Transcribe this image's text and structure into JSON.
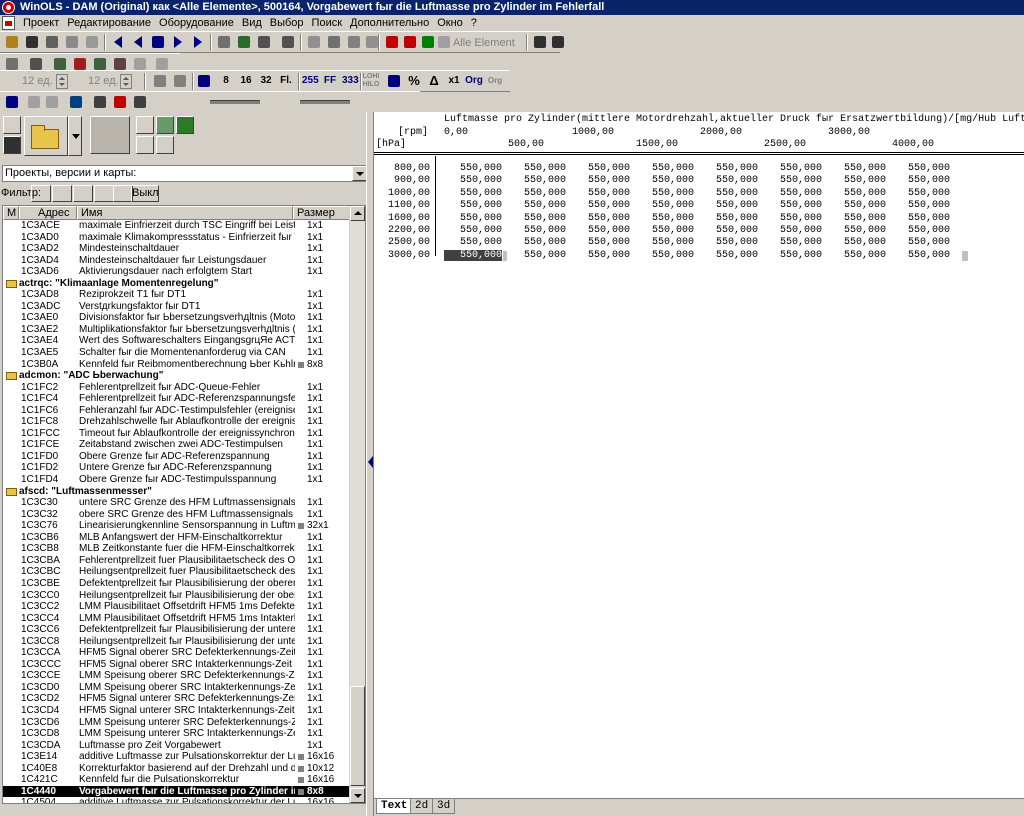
{
  "window": {
    "title": "WinOLS - DAM (Original) как <Alle Elemente>, 500164, Vorgabewert fыr die Luftmasse pro Zylinder im Fehlerfall"
  },
  "menu": [
    "Проект",
    "Редактирование",
    "Оборудование",
    "Вид",
    "Выбор",
    "Поиск",
    "Дополнительно",
    "Окно",
    "?"
  ],
  "toolbar": {
    "elements_label": "Alle Element",
    "width1": "12 ед.",
    "width2": "12 ед.",
    "btn_8": "8",
    "btn_16": "16",
    "btn_32": "32",
    "btn_fl": "Fl.",
    "btn_255": "255",
    "btn_ff": "FF",
    "btn_333": "333",
    "lohi": "LOHI HILO",
    "pct": "%",
    "delta": "Δ",
    "x1": "x1",
    "org": "Org",
    "org2": "Org"
  },
  "left": {
    "project_combo": "Проекты, версии и карты:",
    "filter_label": "Фильтр:",
    "filter_off": "Выкл",
    "columns": {
      "m": "M",
      "addr": "Адрес",
      "name": "Имя",
      "size": "Размер"
    }
  },
  "rows": [
    {
      "addr": "1C3ACE",
      "name": "maximale Einfrierzeit durch TSC Eingriff bei Leistungsre",
      "size": "1x1"
    },
    {
      "addr": "1C3AD0",
      "name": "maximale Klimakompressstatus - Einfrierzeit fыr TSC (I",
      "size": "1x1"
    },
    {
      "addr": "1C3AD2",
      "name": "Mindesteinschaltdauer",
      "size": "1x1"
    },
    {
      "addr": "1C3AD4",
      "name": "Mindesteinschaltdauer fыr Leistungsdauer",
      "size": "1x1"
    },
    {
      "addr": "1C3AD6",
      "name": "Aktivierungsdauer nach erfolgtem Start",
      "size": "1x1"
    },
    {
      "group": "actrqc: \"Klimaanlage Momentenregelung\""
    },
    {
      "addr": "1C3AD8",
      "name": "Reziprokzeit T1 fыr DT1",
      "size": "1x1"
    },
    {
      "addr": "1C3ADC",
      "name": "Verstдrkungsfaktor fыr DT1",
      "size": "1x1"
    },
    {
      "addr": "1C3AE0",
      "name": "Divisionsfaktor fыr Ьbersetzungsverhдltnis (Motor / Kor",
      "size": "1x1"
    },
    {
      "addr": "1C3AE2",
      "name": "Multiplikationsfaktor fыr Ьbersetzungsverhдltnis (Motor",
      "size": "1x1"
    },
    {
      "addr": "1C3AE4",
      "name": "Wert des Softwareschalters EingangsgrцЯe ACTrqC",
      "size": "1x1"
    },
    {
      "addr": "1C3AE5",
      "name": "Schalter fыr die Momentenanforderug via CAN",
      "size": "1x1"
    },
    {
      "addr": "1C3B0A",
      "name": "Kennfeld fыr Reibmomentberechnung Ьber Kьhlmitteld",
      "size": "8x8",
      "mark": true
    },
    {
      "group": "adcmon: \"ADC Ьberwachung\""
    },
    {
      "addr": "1C1FC2",
      "name": "Fehlerentprellzeit fыr ADC-Queue-Fehler",
      "size": "1x1"
    },
    {
      "addr": "1C1FC4",
      "name": "Fehlerentprellzeit fыr ADC-Referenzspannungsfehler",
      "size": "1x1"
    },
    {
      "addr": "1C1FC6",
      "name": "Fehleranzahl fыr ADC-Testimpulsfehler (ereignisentprellt",
      "size": "1x1"
    },
    {
      "addr": "1C1FC8",
      "name": "Drehzahlschwelle fыr Ablaufkontrolle der ereignissynch",
      "size": "1x1"
    },
    {
      "addr": "1C1FCC",
      "name": "Timeout fыr Ablaufkontrolle der ereignissynchronen AD",
      "size": "1x1"
    },
    {
      "addr": "1C1FCE",
      "name": "Zeitabstand zwischen zwei ADC-Testimpulsen",
      "size": "1x1"
    },
    {
      "addr": "1C1FD0",
      "name": "Obere Grenze fыr ADC-Referenzspannung",
      "size": "1x1"
    },
    {
      "addr": "1C1FD2",
      "name": "Untere Grenze fыr ADC-Referenzspannung",
      "size": "1x1"
    },
    {
      "addr": "1C1FD4",
      "name": "Obere Grenze fыr ADC-Testimpulsspannung",
      "size": "1x1"
    },
    {
      "group": "afscd: \"Luftmassenmesser\""
    },
    {
      "addr": "1C3C30",
      "name": "untere SRC Grenze des HFM Luftmassensignals",
      "size": "1x1"
    },
    {
      "addr": "1C3C32",
      "name": "obere SRC Grenze des HFM Luftmassensignals",
      "size": "1x1"
    },
    {
      "addr": "1C3C76",
      "name": "Linearisierungkennline Sensorspannung in Luftmasse p",
      "size": "32x1",
      "mark": true
    },
    {
      "addr": "1C3CB6",
      "name": "MLB Anfangswert der HFM-Einschaltkorrektur",
      "size": "1x1"
    },
    {
      "addr": "1C3CB8",
      "name": "MLB Zeitkonstante fuer die HFM-Einschaltkorrektur",
      "size": "1x1"
    },
    {
      "addr": "1C3CBA",
      "name": "Fehlerentprellzeit fuer Plausibilitaetscheck des Offsetdr",
      "size": "1x1"
    },
    {
      "addr": "1C3CBC",
      "name": "Heilungsentprellzeit fuer Plausibilitaetscheck des Offse",
      "size": "1x1"
    },
    {
      "addr": "1C3CBE",
      "name": "Defektentprellzeit fыr Plausibilisierung der oberen Luftm",
      "size": "1x1"
    },
    {
      "addr": "1C3CC0",
      "name": "Heilungsentprellzeit fыr Plausibilisierung der oberen Luf",
      "size": "1x1"
    },
    {
      "addr": "1C3CC2",
      "name": "LMM Plausibilitaet Offsetdrift HFM5 1ms Defekterkenn",
      "size": "1x1"
    },
    {
      "addr": "1C3CC4",
      "name": "LMM Plausibilitaet Offsetdrift HFM5 1ms Intakterkenn",
      "size": "1x1"
    },
    {
      "addr": "1C3CC6",
      "name": "Defektentprellzeit fыr Plausibilisierung der unteren Luftn",
      "size": "1x1"
    },
    {
      "addr": "1C3CC8",
      "name": "Heilungsentprellzeit fыr Plausibilisierung der unteren Lul",
      "size": "1x1"
    },
    {
      "addr": "1C3CCA",
      "name": "HFM5 Signal oberer SRC Defekterkennungs-Zeit",
      "size": "1x1"
    },
    {
      "addr": "1C3CCC",
      "name": "HFM5 Signal oberer SRC Intakterkennungs-Zeit",
      "size": "1x1"
    },
    {
      "addr": "1C3CCE",
      "name": "LMM  Speisung oberer  SRC  Defekterkennungs-Zeit",
      "size": "1x1"
    },
    {
      "addr": "1C3CD0",
      "name": "LMM  Speisung oberer  SRC  Intakterkennungs-Zeit",
      "size": "1x1"
    },
    {
      "addr": "1C3CD2",
      "name": "HFM5 Signal unterer SRC Defekterkennungs-Zeit",
      "size": "1x1"
    },
    {
      "addr": "1C3CD4",
      "name": "HFM5 Signal unterer SRC Intakterkennungs-Zeit",
      "size": "1x1"
    },
    {
      "addr": "1C3CD6",
      "name": "LMM  Speisung unterer  SRC  Defekterkennungs-Zeit",
      "size": "1x1"
    },
    {
      "addr": "1C3CD8",
      "name": "LMM  Speisung unterer  SRC  Intakterkennungs-Zeit",
      "size": "1x1"
    },
    {
      "addr": "1C3CDA",
      "name": "Luftmasse pro Zeit Vorgabewert",
      "size": "1x1"
    },
    {
      "addr": "1C3E14",
      "name": "additive Luftmasse zur Pulsationskorrektur der Luftmass",
      "size": "16x16",
      "mark": true
    },
    {
      "addr": "1C40E8",
      "name": "Korrekturfaktor basierend auf der Drehzahl und der Me",
      "size": "10x12",
      "mark": true
    },
    {
      "addr": "1C421C",
      "name": "Kennfeld fыr die Pulsationskorrektur",
      "size": "16x16",
      "mark": true
    },
    {
      "addr": "1C4440",
      "name": "Vorgabewert fыr die Luftmasse pro Zylinder im",
      "size": "8x8",
      "mark": true,
      "selected": true
    },
    {
      "addr": "1C4504",
      "name": "additive Luftmasse zur Pulsationskorrektur der Luftmass",
      "size": "16x16"
    }
  ],
  "map": {
    "title": "Luftmasse pro Zylinder(mittlere Motordrehzahl,aktueller Druck fыr Ersatzwertbildung)/[mg/Hub Luft]",
    "x_unit": "[rpm]",
    "y_unit": "[hPa]",
    "x_axis_upper": [
      "0,00",
      "1000,00",
      "2000,00",
      "3000,00"
    ],
    "x_axis_lower": [
      "500,00",
      "1500,00",
      "2500,00",
      "4000,00"
    ],
    "y_axis": [
      "800,00",
      "900,00",
      "1000,00",
      "1100,00",
      "1600,00",
      "2200,00",
      "2500,00",
      "3000,00"
    ],
    "cell_value": "550,000",
    "selected_cell": "550,000"
  },
  "tabs": [
    "Text",
    "2d",
    "3d"
  ]
}
